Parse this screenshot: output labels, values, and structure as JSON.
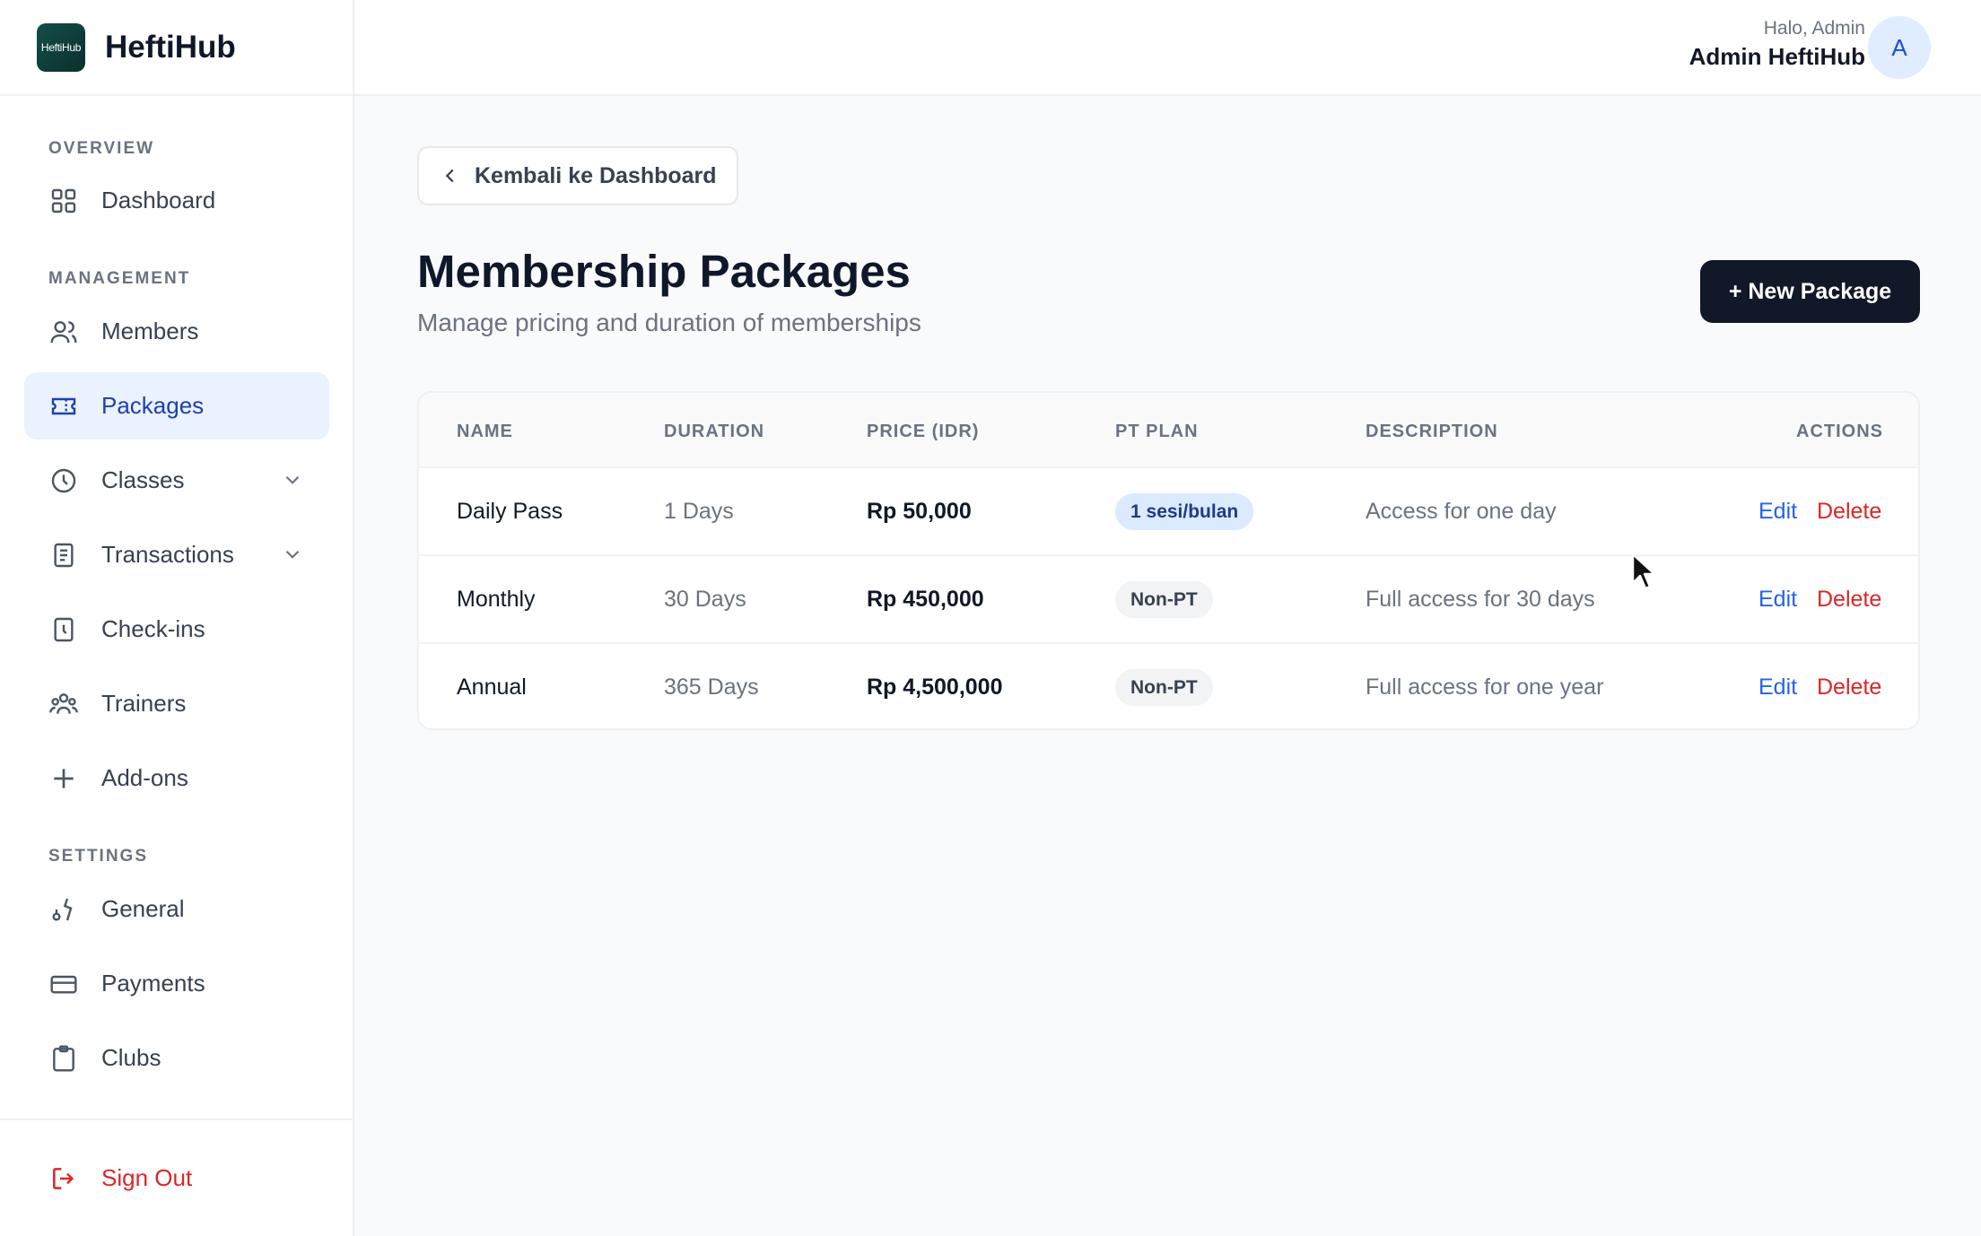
{
  "brand": {
    "logo_text": "HeftiHub",
    "name": "HeftiHub"
  },
  "sidebar": {
    "sections": {
      "overview": "OVERVIEW",
      "management": "MANAGEMENT",
      "settings": "SETTINGS"
    },
    "items": [
      {
        "label": "Dashboard",
        "icon": "grid-icon"
      },
      {
        "label": "Members",
        "icon": "users-icon"
      },
      {
        "label": "Packages",
        "icon": "ticket-icon",
        "active": true
      },
      {
        "label": "Classes",
        "icon": "clock-icon",
        "expandable": true
      },
      {
        "label": "Transactions",
        "icon": "document-icon",
        "expandable": true
      },
      {
        "label": "Check-ins",
        "icon": "checkin-icon"
      },
      {
        "label": "Trainers",
        "icon": "group-icon"
      },
      {
        "label": "Add-ons",
        "icon": "plus-icon"
      },
      {
        "label": "General",
        "icon": "settings-icon"
      },
      {
        "label": "Payments",
        "icon": "card-icon"
      },
      {
        "label": "Clubs",
        "icon": "clipboard-icon"
      }
    ],
    "sign_out": "Sign Out"
  },
  "header": {
    "greeting": "Halo, Admin",
    "user_name": "Admin HeftiHub",
    "avatar_initial": "A"
  },
  "main": {
    "back_label": "Kembali ke Dashboard",
    "title": "Membership Packages",
    "subtitle": "Manage pricing and duration of memberships",
    "new_button": "+ New Package",
    "table": {
      "columns": [
        "NAME",
        "DURATION",
        "PRICE (IDR)",
        "PT PLAN",
        "DESCRIPTION",
        "ACTIONS"
      ],
      "rows": [
        {
          "name": "Daily Pass",
          "duration": "1 Days",
          "price": "Rp 50,000",
          "pt_plan": "1 sesi/bulan",
          "description": "Access for one day",
          "edit": "Edit",
          "delete": "Delete"
        },
        {
          "name": "Monthly",
          "duration": "30 Days",
          "price": "Rp 450,000",
          "pt_plan": "Non-PT",
          "description": "Full access for 30 days",
          "edit": "Edit",
          "delete": "Delete"
        },
        {
          "name": "Annual",
          "duration": "365 Days",
          "price": "Rp 4,500,000",
          "pt_plan": "Non-PT",
          "description": "Full access for one year",
          "edit": "Edit",
          "delete": "Delete"
        }
      ]
    }
  },
  "colors": {
    "accent": "#1e40af",
    "primary_button": "#111827",
    "danger": "#dc2626",
    "link": "#2563eb"
  }
}
